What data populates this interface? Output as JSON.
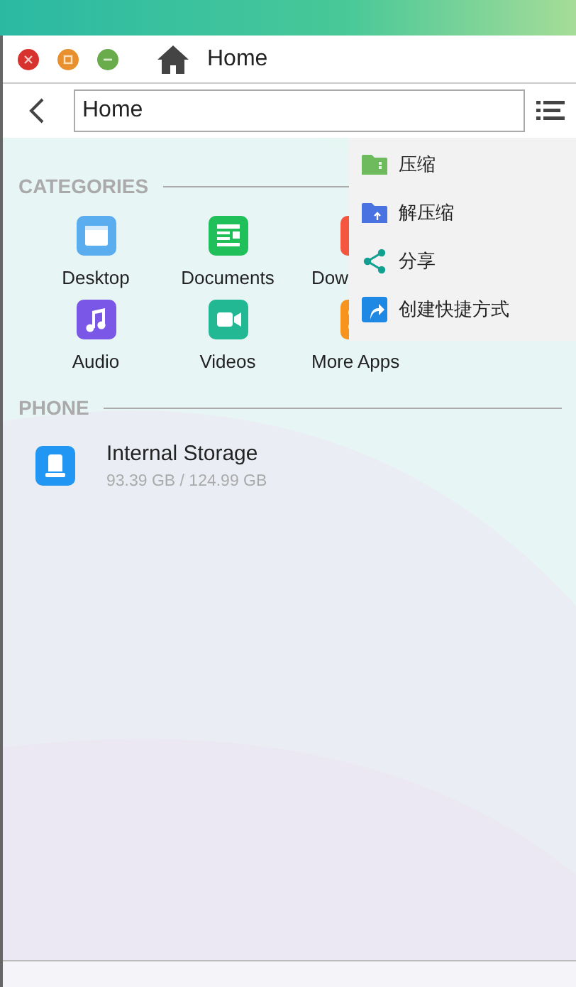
{
  "window": {
    "title": "Home"
  },
  "toolbar": {
    "path": "Home"
  },
  "sections": [
    {
      "kind": "grid",
      "title": "CATEGORIES",
      "items": [
        {
          "label": "Desktop",
          "kind": "desktop",
          "color": "#5aaef0"
        },
        {
          "label": "Documents",
          "kind": "documents",
          "color": "#1fbf5a"
        },
        {
          "label": "Dow",
          "kind": "download",
          "color": "#f5563e"
        },
        {
          "label": "Audio",
          "kind": "audio",
          "color": "#7b57e8"
        },
        {
          "label": "Videos",
          "kind": "videos",
          "color": "#22b894"
        },
        {
          "label": "More Apps",
          "kind": "apps",
          "color": "#f7941d"
        }
      ]
    },
    {
      "kind": "list",
      "title": "PHONE",
      "items": [
        {
          "label": "Internal Storage",
          "detail": "93.39 GB / 124.99 GB",
          "kind": "storage",
          "color": "#2196f3"
        }
      ]
    }
  ],
  "context_menu": {
    "items": [
      {
        "label": "压缩",
        "kind": "compress"
      },
      {
        "label": "解压缩",
        "kind": "extract"
      },
      {
        "label": "分享",
        "kind": "share"
      },
      {
        "label": "创建快捷方式",
        "kind": "shortcut"
      }
    ]
  }
}
